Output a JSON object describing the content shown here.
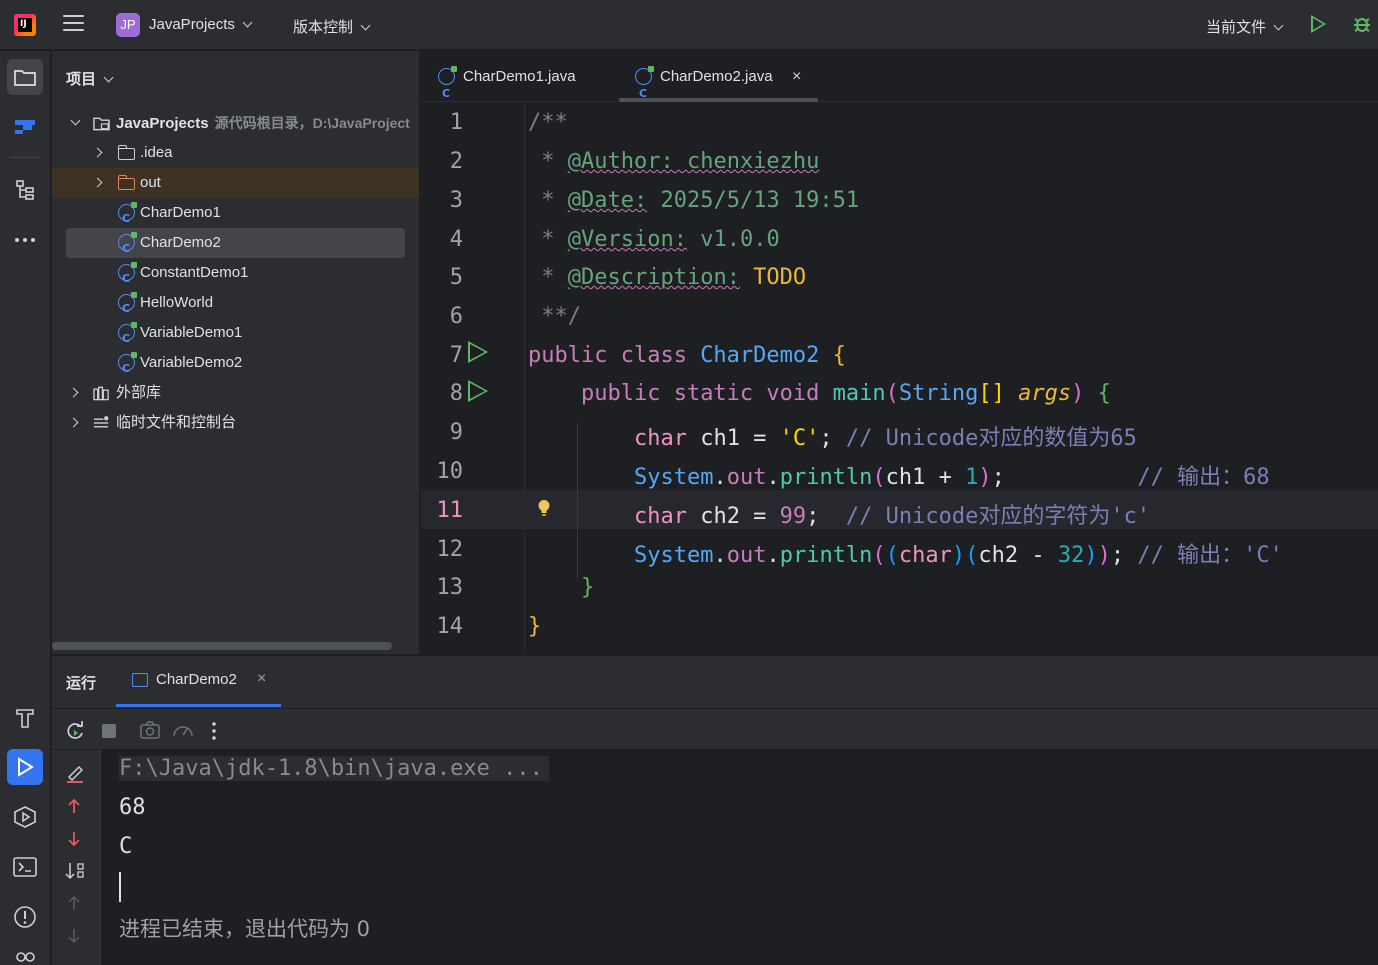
{
  "titlebar": {
    "project_badge": "JP",
    "project_name": "JavaProjects",
    "vcs_label": "版本控制",
    "current_file_label": "当前文件"
  },
  "project_panel": {
    "title": "项目",
    "tree": [
      {
        "label": "JavaProjects",
        "sub": "源代码根目录，D:\\JavaProject",
        "kind": "root"
      },
      {
        "label": ".idea",
        "kind": "folder"
      },
      {
        "label": "out",
        "kind": "folder-excluded"
      },
      {
        "label": "CharDemo1",
        "kind": "class"
      },
      {
        "label": "CharDemo2",
        "kind": "class",
        "selected": true
      },
      {
        "label": "ConstantDemo1",
        "kind": "class"
      },
      {
        "label": "HelloWorld",
        "kind": "class"
      },
      {
        "label": "VariableDemo1",
        "kind": "class"
      },
      {
        "label": "VariableDemo2",
        "kind": "class"
      },
      {
        "label": "外部库",
        "kind": "library"
      },
      {
        "label": "临时文件和控制台",
        "kind": "scratch"
      }
    ]
  },
  "editor": {
    "tabs": [
      {
        "label": "CharDemo1.java",
        "active": false
      },
      {
        "label": "CharDemo2.java",
        "active": true,
        "close": "×"
      }
    ],
    "current_line": 11,
    "line_numbers": [
      "1",
      "2",
      "3",
      "4",
      "5",
      "6",
      "7",
      "8",
      "9",
      "10",
      "11",
      "12",
      "13",
      "14"
    ],
    "code": {
      "l1": "/**",
      "l2_star": " * ",
      "l2_tag": "@Author:",
      "l2_val": " chenxiezhu",
      "l3_star": " * ",
      "l3_tag": "@Date:",
      "l3_val": " 2025/5/13 19:51",
      "l4_star": " * ",
      "l4_tag": "@Version:",
      "l4_val": " v1.0.0",
      "l5_star": " * ",
      "l5_tag": "@Description:",
      "l5_val": " TODO",
      "l6": " **/",
      "l7_kw": "public class ",
      "l7_name": "CharDemo2 ",
      "l7_brace": "{",
      "l8_indent": "    ",
      "l8_kw": "public static void ",
      "l8_fn": "main",
      "l8_p1": "(",
      "l8_type": "String",
      "l8_arr": "[] ",
      "l8_arg": "args",
      "l8_p2": ")",
      "l8_sp": " ",
      "l8_brace": "{",
      "l9_indent": "        ",
      "l9_kw": "char",
      "l9_var": " ch1 = ",
      "l9_str": "'C'",
      "l9_semi": "; ",
      "l9_com": "// Unicode对应的数值为65",
      "l10_indent": "        ",
      "l10_sys": "System",
      "l10_dot": ".",
      "l10_out": "out",
      "l10_dot2": ".",
      "l10_fn": "println",
      "l10_p1": "(",
      "l10_mid": "ch1 + ",
      "l10_num": "1",
      "l10_p2": ")",
      "l10_semi": ";",
      "l10_pad": "          ",
      "l10_com": "// 输出：68",
      "l11_indent": "        ",
      "l11_kw": "char",
      "l11_var": " ch2 = ",
      "l11_num": "99",
      "l11_semi": ";  ",
      "l11_com": "// Unicode对应的字符为'c'",
      "l12_indent": "        ",
      "l12_sys": "System",
      "l12_dot": ".",
      "l12_out": "out",
      "l12_dot2": ".",
      "l12_fn": "println",
      "l12_p1": "(",
      "l12_p2": "(",
      "l12_kw": "char",
      "l12_p3": ")",
      "l12_p4": "(",
      "l12_mid": "ch2 - ",
      "l12_num": "32",
      "l12_p5": ")",
      "l12_p6": ")",
      "l12_semi": "; ",
      "l12_com": "// 输出：'C'",
      "l13": "    }",
      "l14": "}"
    }
  },
  "run_panel": {
    "title": "运行",
    "tab_label": "CharDemo2",
    "tab_close": "×",
    "console": {
      "command": "F:\\Java\\jdk-1.8\\bin\\java.exe ...",
      "out1": "68",
      "out2": "C",
      "exit": "进程已结束，退出代码为 0"
    }
  },
  "colors": {
    "accent": "#3574f0",
    "run_green": "#5fb865",
    "keyword": "#cf8e6d",
    "function": "#56a8f5",
    "number": "#2aacb8"
  }
}
